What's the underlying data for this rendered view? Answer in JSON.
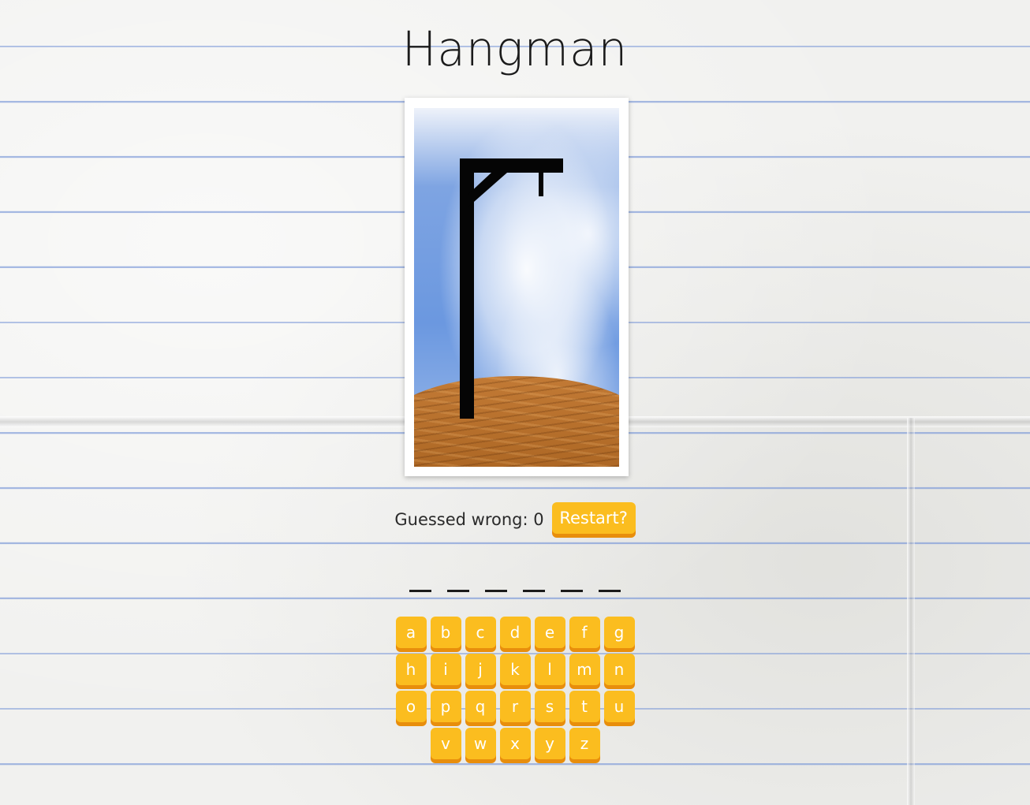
{
  "title": "Hangman",
  "status": {
    "label": "Guessed wrong: 0",
    "restart_label": "Restart?"
  },
  "word": {
    "blanks": [
      "",
      "",
      "",
      "",
      "",
      ""
    ]
  },
  "keyboard": {
    "rows": [
      [
        "a",
        "b",
        "c",
        "d",
        "e",
        "f",
        "g"
      ],
      [
        "h",
        "i",
        "j",
        "k",
        "l",
        "m",
        "n"
      ],
      [
        "o",
        "p",
        "q",
        "r",
        "s",
        "t",
        "u"
      ],
      [
        "v",
        "w",
        "x",
        "y",
        "z"
      ]
    ]
  },
  "colors": {
    "button": "#fbbd1f",
    "button_shadow": "#e88e0c",
    "line": "#7896d7"
  }
}
